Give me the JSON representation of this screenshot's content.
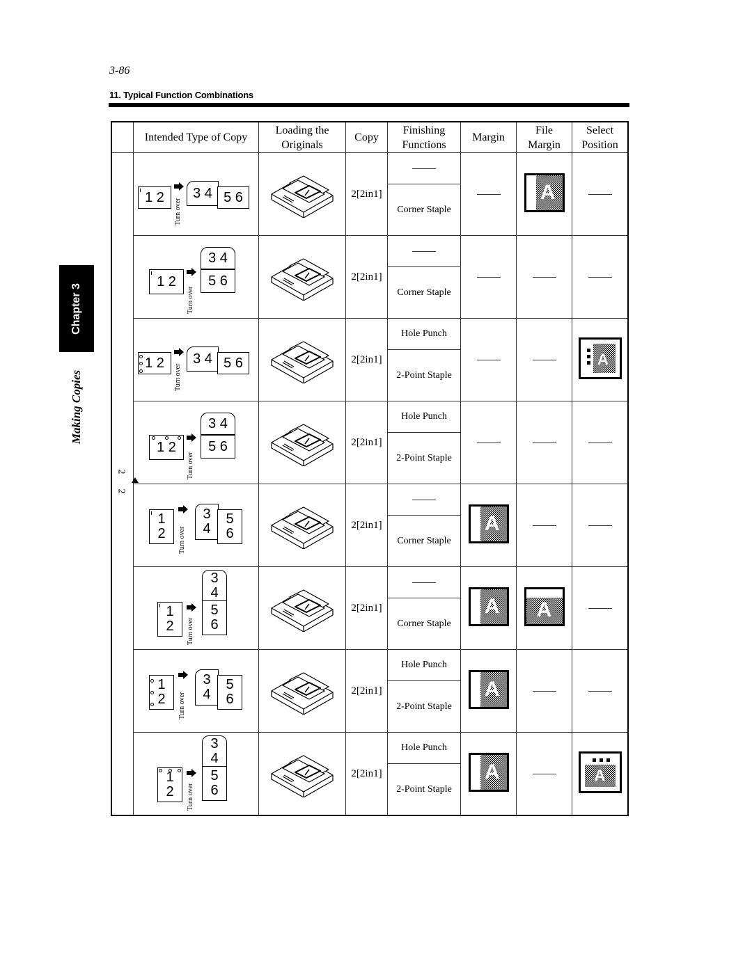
{
  "page_number": "3-86",
  "section_title": "11. Typical Function Combinations",
  "side_tab": {
    "chapter": "Chapter 3",
    "subtitle": "Making Copies"
  },
  "table": {
    "headers": {
      "intended_type": "Intended Type of Copy",
      "loading": [
        "Loading the",
        "Originals"
      ],
      "copy": "Copy",
      "finishing": [
        "Finishing",
        "Functions"
      ],
      "margin": "Margin",
      "file_margin": [
        "File",
        "Margin"
      ],
      "select_position": [
        "Select",
        "Position"
      ]
    },
    "side_group_label": "2 → 2",
    "side_group_chars": [
      "2",
      "2"
    ],
    "turn_over_label": "Turn over",
    "rows": [
      {
        "original": "1 2",
        "pages": [
          "3 4",
          "5 6"
        ],
        "orientation": "landscape-book",
        "punch": "none",
        "copy": "2[2in1]",
        "finishing_top": "——",
        "finishing_bottom": "Corner Staple",
        "margin": "——",
        "file_margin": "left-margin-icon",
        "select_position": "——"
      },
      {
        "original": "1 2",
        "pages": [
          "3 4",
          "5 6"
        ],
        "orientation": "landscape-calendar",
        "punch": "none",
        "copy": "2[2in1]",
        "finishing_top": "——",
        "finishing_bottom": "Corner Staple",
        "margin": "——",
        "file_margin": "——",
        "select_position": "——"
      },
      {
        "original": "1 2",
        "pages": [
          "3 4",
          "5 6"
        ],
        "orientation": "landscape-book",
        "punch": "left",
        "copy": "2[2in1]",
        "finishing_top": "Hole Punch",
        "finishing_bottom": "2-Point Staple",
        "margin": "——",
        "file_margin": "——",
        "select_position": "left-punch-position-icon"
      },
      {
        "original": "1 2",
        "pages": [
          "3 4",
          "5 6"
        ],
        "orientation": "landscape-calendar",
        "punch": "top",
        "copy": "2[2in1]",
        "finishing_top": "Hole Punch",
        "finishing_bottom": "2-Point Staple",
        "margin": "——",
        "file_margin": "——",
        "select_position": "——"
      },
      {
        "original": "1\n2",
        "pages": [
          "3\n4",
          "5\n6"
        ],
        "orientation": "portrait-book",
        "punch": "none",
        "copy": "2[2in1]",
        "finishing_top": "——",
        "finishing_bottom": "Corner Staple",
        "margin": "left-margin-icon",
        "file_margin": "——",
        "select_position": "——"
      },
      {
        "original": "1\n2",
        "pages": [
          "3\n4",
          "5\n6"
        ],
        "orientation": "portrait-calendar",
        "punch": "none",
        "copy": "2[2in1]",
        "finishing_top": "——",
        "finishing_bottom": "Corner Staple",
        "margin": "left-margin-icon",
        "file_margin": "top-margin-icon",
        "select_position": "——"
      },
      {
        "original": "1\n2",
        "pages": [
          "3\n4",
          "5\n6"
        ],
        "orientation": "portrait-book",
        "punch": "left",
        "copy": "2[2in1]",
        "finishing_top": "Hole Punch",
        "finishing_bottom": "2-Point Staple",
        "margin": "left-margin-icon",
        "file_margin": "——",
        "select_position": "——"
      },
      {
        "original": "1\n2",
        "pages": [
          "3\n4",
          "5\n6"
        ],
        "orientation": "portrait-calendar",
        "punch": "top",
        "copy": "2[2in1]",
        "finishing_top": "Hole Punch",
        "finishing_bottom": "2-Point Staple",
        "margin": "left-margin-icon",
        "file_margin": "——",
        "select_position": "top-punch-position-icon"
      }
    ]
  },
  "icon_glyphs": {
    "margin_letter": "A",
    "adf_page": "1"
  }
}
